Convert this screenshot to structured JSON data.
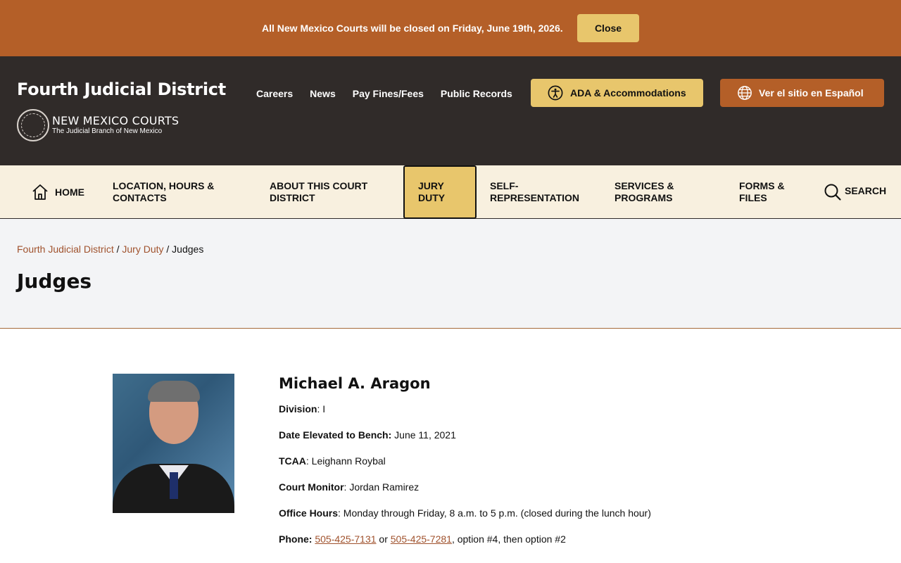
{
  "alert": {
    "message": "All New Mexico Courts will be closed on Friday, June 19th, 2026.",
    "close_label": "Close"
  },
  "header": {
    "site_title": "Fourth Judicial District",
    "logo_main": "NEW MEXICO COURTS",
    "logo_sub": "The Judicial Branch of New Mexico",
    "util_links": [
      "Careers",
      "News",
      "Pay Fines/Fees",
      "Public Records"
    ],
    "ada_label": "ADA & Accommodations",
    "spanish_label": "Ver el sitio en Español"
  },
  "nav": {
    "home": "HOME",
    "items": [
      [
        "LOCATION, HOURS &",
        "CONTACTS"
      ],
      [
        "ABOUT THIS COURT",
        "DISTRICT"
      ],
      [
        "JURY",
        "DUTY"
      ],
      [
        "SELF-",
        "REPRESENTATION"
      ],
      [
        "SERVICES &",
        "PROGRAMS"
      ],
      [
        "FORMS &",
        "FILES"
      ]
    ],
    "search": "SEARCH"
  },
  "breadcrumb": {
    "items": [
      "Fourth Judicial District",
      "Jury Duty"
    ],
    "current": "Judges",
    "separator": "/"
  },
  "page": {
    "title": "Judges"
  },
  "judge": {
    "name": "Michael A. Aragon",
    "division_label": "Division",
    "division": "I",
    "elevated_label": "Date Elevated to Bench:",
    "elevated": "June 11, 2021",
    "tcaa_label": "TCAA",
    "tcaa": "Leighann Roybal",
    "monitor_label": "Court Monitor",
    "monitor": "Jordan Ramirez",
    "hours_label": "Office Hours",
    "hours": "Monday through Friday, 8 a.m. to 5 p.m. (closed during the lunch hour)",
    "phone_label": "Phone:",
    "phone1": "505-425-7131",
    "phone_or": "or",
    "phone2": "505-425-7281",
    "phone_suffix": ", option #4, then option #2"
  },
  "colors": {
    "accent": "#b45f28",
    "gold": "#e8c66c",
    "header_bg": "#302b29",
    "nav_bg": "#f8f0df"
  }
}
